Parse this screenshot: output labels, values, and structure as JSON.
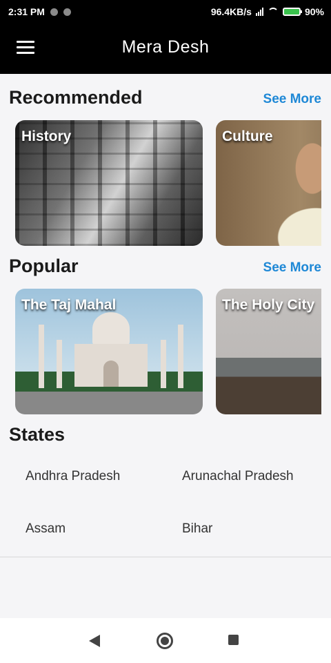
{
  "status_bar": {
    "time": "2:31 PM",
    "network_speed": "96.4KB/s",
    "battery": "90%"
  },
  "app_bar": {
    "title": "Mera Desh",
    "menu_icon": "hamburger-menu-icon"
  },
  "recommended": {
    "title": "Recommended",
    "see_more": "See More",
    "cards": [
      {
        "label": "History"
      },
      {
        "label": "Culture"
      }
    ]
  },
  "popular": {
    "title": "Popular",
    "see_more": "See More",
    "cards": [
      {
        "label": "The Taj Mahal"
      },
      {
        "label": "The Holy City"
      }
    ]
  },
  "states": {
    "title": "States",
    "items": [
      "Andhra Pradesh",
      "Arunachal Pradesh",
      "Assam",
      "Bihar"
    ]
  },
  "nav_bar": {
    "icons": [
      "back-icon",
      "home-icon",
      "recents-icon"
    ]
  },
  "colors": {
    "accent": "#1e88d6",
    "app_bar": "#000000",
    "background": "#f5f5f7"
  }
}
